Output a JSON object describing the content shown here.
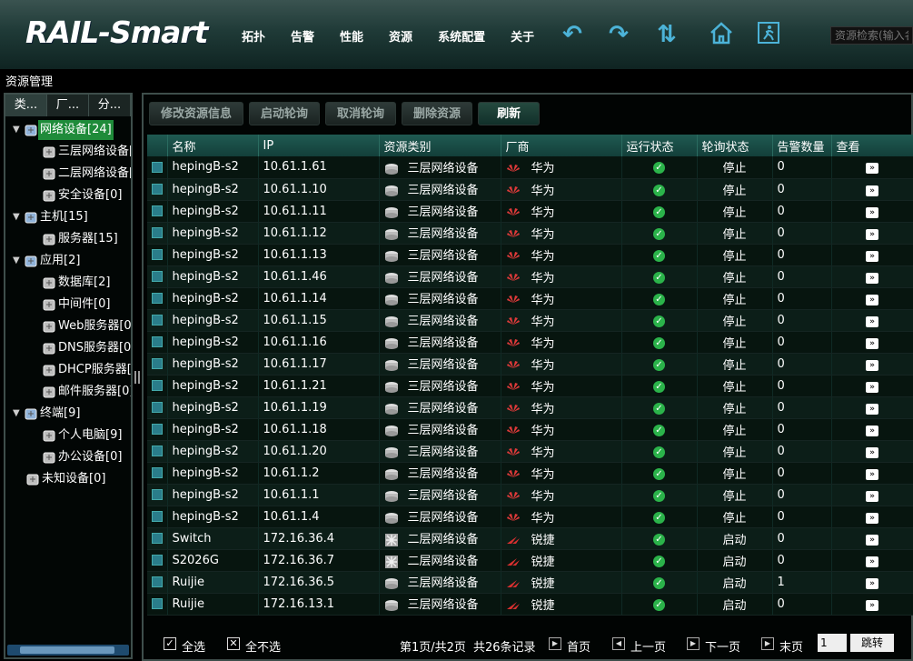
{
  "header": {
    "logo": "RAIL-Smart",
    "nav": [
      "拓扑",
      "告警",
      "性能",
      "资源",
      "系统配置",
      "关于"
    ],
    "search_placeholder": "资源检索(输入名"
  },
  "breadcrumb": "资源管理",
  "left": {
    "tabs": [
      "类...",
      "厂...",
      "分..."
    ],
    "tree": [
      {
        "label": "网络设备[24]",
        "level": 0,
        "selected": true
      },
      {
        "label": "三层网络设备[",
        "level": 1
      },
      {
        "label": "二层网络设备[",
        "level": 1
      },
      {
        "label": "安全设备[0]",
        "level": 1
      },
      {
        "label": "主机[15]",
        "level": 0
      },
      {
        "label": "服务器[15]",
        "level": 1
      },
      {
        "label": "应用[2]",
        "level": 0
      },
      {
        "label": "数据库[2]",
        "level": 1
      },
      {
        "label": "中间件[0]",
        "level": 1
      },
      {
        "label": "Web服务器[0",
        "level": 1
      },
      {
        "label": "DNS服务器[0",
        "level": 1
      },
      {
        "label": "DHCP服务器[",
        "level": 1
      },
      {
        "label": "邮件服务器[0]",
        "level": 1
      },
      {
        "label": "终端[9]",
        "level": 0
      },
      {
        "label": "个人电脑[9]",
        "level": 1
      },
      {
        "label": "办公设备[0]",
        "level": 1
      },
      {
        "label": "未知设备[0]",
        "level": -1
      }
    ]
  },
  "toolbar": {
    "edit": "修改资源信息",
    "start_poll": "启动轮询",
    "cancel_poll": "取消轮询",
    "delete": "删除资源",
    "refresh": "刷新"
  },
  "table": {
    "columns": [
      "名称",
      "IP",
      "资源类别",
      "厂商",
      "运行状态",
      "轮询状态",
      "告警数量",
      "查看"
    ],
    "rows": [
      {
        "name": "hepingB-s2",
        "ip": "10.61.1.61",
        "type": "三层网络设备",
        "vendor": "华为",
        "poll": "停止",
        "alarms": "0"
      },
      {
        "name": "hepingB-s2",
        "ip": "10.61.1.10",
        "type": "三层网络设备",
        "vendor": "华为",
        "poll": "停止",
        "alarms": "0"
      },
      {
        "name": "hepingB-s2",
        "ip": "10.61.1.11",
        "type": "三层网络设备",
        "vendor": "华为",
        "poll": "停止",
        "alarms": "0"
      },
      {
        "name": "hepingB-s2",
        "ip": "10.61.1.12",
        "type": "三层网络设备",
        "vendor": "华为",
        "poll": "停止",
        "alarms": "0"
      },
      {
        "name": "hepingB-s2",
        "ip": "10.61.1.13",
        "type": "三层网络设备",
        "vendor": "华为",
        "poll": "停止",
        "alarms": "0"
      },
      {
        "name": "hepingB-s2",
        "ip": "10.61.1.46",
        "type": "三层网络设备",
        "vendor": "华为",
        "poll": "停止",
        "alarms": "0"
      },
      {
        "name": "hepingB-s2",
        "ip": "10.61.1.14",
        "type": "三层网络设备",
        "vendor": "华为",
        "poll": "停止",
        "alarms": "0"
      },
      {
        "name": "hepingB-s2",
        "ip": "10.61.1.15",
        "type": "三层网络设备",
        "vendor": "华为",
        "poll": "停止",
        "alarms": "0"
      },
      {
        "name": "hepingB-s2",
        "ip": "10.61.1.16",
        "type": "三层网络设备",
        "vendor": "华为",
        "poll": "停止",
        "alarms": "0"
      },
      {
        "name": "hepingB-s2",
        "ip": "10.61.1.17",
        "type": "三层网络设备",
        "vendor": "华为",
        "poll": "停止",
        "alarms": "0"
      },
      {
        "name": "hepingB-s2",
        "ip": "10.61.1.21",
        "type": "三层网络设备",
        "vendor": "华为",
        "poll": "停止",
        "alarms": "0"
      },
      {
        "name": "hepingB-s2",
        "ip": "10.61.1.19",
        "type": "三层网络设备",
        "vendor": "华为",
        "poll": "停止",
        "alarms": "0"
      },
      {
        "name": "hepingB-s2",
        "ip": "10.61.1.18",
        "type": "三层网络设备",
        "vendor": "华为",
        "poll": "停止",
        "alarms": "0"
      },
      {
        "name": "hepingB-s2",
        "ip": "10.61.1.20",
        "type": "三层网络设备",
        "vendor": "华为",
        "poll": "停止",
        "alarms": "0"
      },
      {
        "name": "hepingB-s2",
        "ip": "10.61.1.2",
        "type": "三层网络设备",
        "vendor": "华为",
        "poll": "停止",
        "alarms": "0"
      },
      {
        "name": "hepingB-s2",
        "ip": "10.61.1.1",
        "type": "三层网络设备",
        "vendor": "华为",
        "poll": "停止",
        "alarms": "0"
      },
      {
        "name": "hepingB-s2",
        "ip": "10.61.1.4",
        "type": "三层网络设备",
        "vendor": "华为",
        "poll": "停止",
        "alarms": "0"
      },
      {
        "name": "Switch",
        "ip": "172.16.36.4",
        "type": "二层网络设备",
        "vendor": "锐捷",
        "poll": "启动",
        "alarms": "0"
      },
      {
        "name": "S2026G",
        "ip": "172.16.36.7",
        "type": "二层网络设备",
        "vendor": "锐捷",
        "poll": "启动",
        "alarms": "0"
      },
      {
        "name": "Ruijie",
        "ip": "172.16.36.5",
        "type": "三层网络设备",
        "vendor": "锐捷",
        "poll": "启动",
        "alarms": "1"
      },
      {
        "name": "Ruijie",
        "ip": "172.16.13.1",
        "type": "三层网络设备",
        "vendor": "锐捷",
        "poll": "启动",
        "alarms": "0"
      }
    ]
  },
  "footer": {
    "select_all": "全选",
    "select_none": "全不选",
    "page_info": "第1页/共2页",
    "total": "共26条记录",
    "first": "首页",
    "prev": "上一页",
    "next": "下一页",
    "last": "末页",
    "page_input": "1",
    "go": "跳转"
  }
}
